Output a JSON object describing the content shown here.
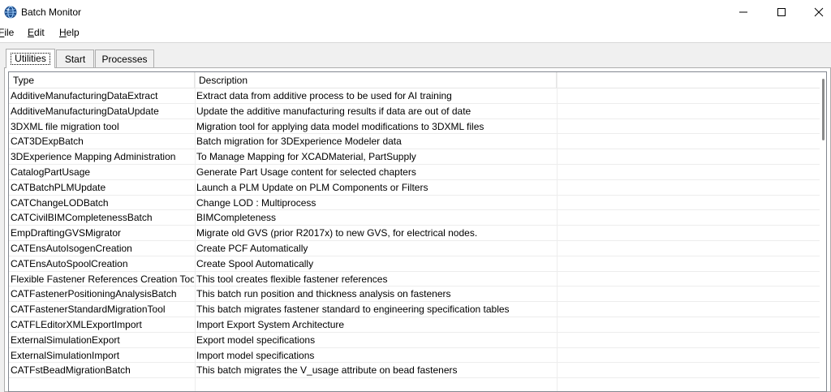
{
  "window": {
    "title": "Batch Monitor",
    "icons": {
      "app": "globe-app-icon",
      "minimize": "minimize-icon",
      "maximize": "maximize-icon",
      "close": "close-icon"
    }
  },
  "menu": {
    "file": {
      "underline": "F",
      "rest": "ile"
    },
    "edit": {
      "underline": "E",
      "rest": "dit"
    },
    "help": {
      "underline": "H",
      "rest": "elp"
    }
  },
  "tabs": {
    "utilities": "Utilities",
    "start": "Start",
    "processes": "Processes",
    "selected": "Utilities"
  },
  "table": {
    "columns": {
      "type": "Type",
      "description": "Description"
    },
    "rows": [
      {
        "type": "AdditiveManufacturingDataExtract",
        "description": "Extract data from additive process to be used for AI training"
      },
      {
        "type": "AdditiveManufacturingDataUpdate",
        "description": "Update the additive manufacturing results if data are out of date"
      },
      {
        "type": "3DXML file migration tool",
        "description": "Migration tool for applying data model modifications to 3DXML files"
      },
      {
        "type": "CAT3DExpBatch",
        "description": "Batch migration for 3DExperience Modeler data"
      },
      {
        "type": "3DExperience Mapping Administration",
        "description": "To Manage Mapping for XCADMaterial, PartSupply"
      },
      {
        "type": "CatalogPartUsage",
        "description": "Generate Part Usage content for selected chapters"
      },
      {
        "type": "CATBatchPLMUpdate",
        "description": "Launch a PLM Update on PLM Components or Filters"
      },
      {
        "type": "CATChangeLODBatch",
        "description": "Change LOD : Multiprocess"
      },
      {
        "type": "CATCivilBIMCompletenessBatch",
        "description": "BIMCompleteness"
      },
      {
        "type": "EmpDraftingGVSMigrator",
        "description": "Migrate old GVS (prior R2017x) to new GVS, for electrical nodes."
      },
      {
        "type": "CATEnsAutoIsogenCreation",
        "description": "Create PCF Automatically"
      },
      {
        "type": "CATEnsAutoSpoolCreation",
        "description": "Create Spool Automatically"
      },
      {
        "type": "Flexible Fastener References Creation Tool",
        "description": "This tool creates flexible fastener references"
      },
      {
        "type": "CATFastenerPositioningAnalysisBatch",
        "description": "This batch run position and thickness analysis on fasteners"
      },
      {
        "type": "CATFastenerStandardMigrationTool",
        "description": "This batch migrates fastener standard to engineering specification tables"
      },
      {
        "type": "CATFLEditorXMLExportImport",
        "description": "Import Export System Architecture"
      },
      {
        "type": "ExternalSimulationExport",
        "description": "Export model specifications"
      },
      {
        "type": "ExternalSimulationImport",
        "description": "Import model specifications"
      },
      {
        "type": "CATFstBeadMigrationBatch",
        "description": "This batch migrates the V_usage attribute on bead fasteners"
      }
    ]
  },
  "colors": {
    "tab_bg": "#f0f0f0",
    "border": "#adadad",
    "list_border": "#828790",
    "scroll_thumb": "#8a8a8a"
  }
}
